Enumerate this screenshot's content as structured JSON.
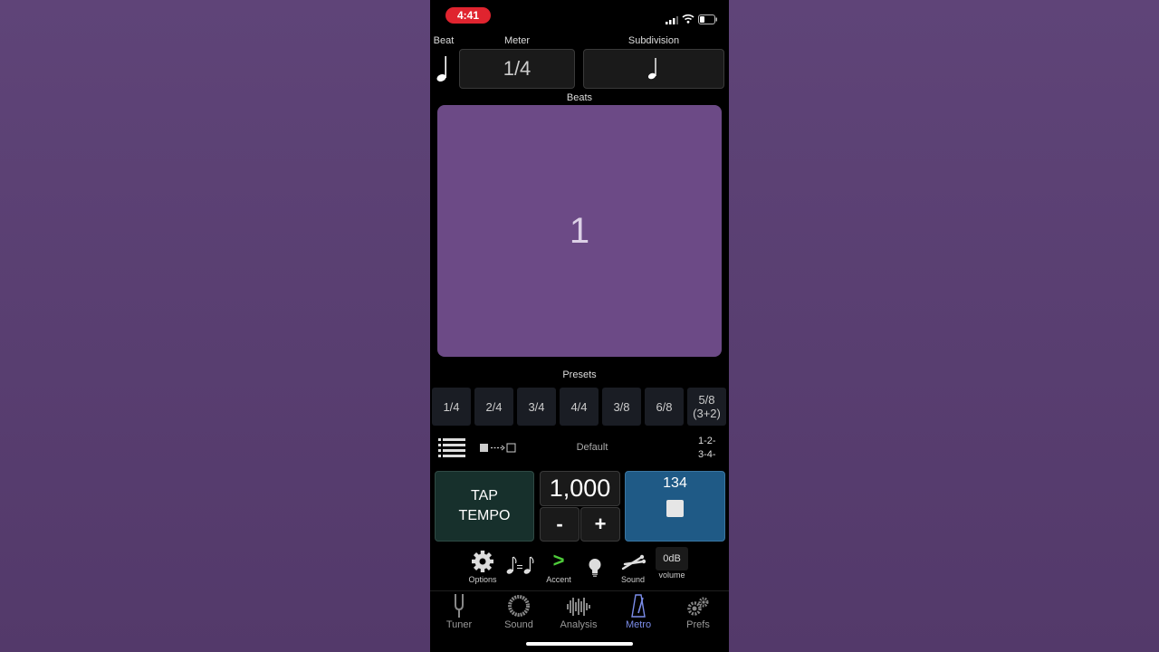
{
  "status": {
    "time": "4:41"
  },
  "header": {
    "beat_label": "Beat",
    "meter_label": "Meter",
    "subdivision_label": "Subdivision",
    "meter_value": "1/4",
    "beats_label": "Beats"
  },
  "beats": {
    "current": "1"
  },
  "presets": {
    "label": "Presets",
    "items": [
      "1/4",
      "2/4",
      "3/4",
      "4/4",
      "3/8",
      "6/8",
      "5/8"
    ],
    "last_sub": "(3+2)",
    "default_label": "Default",
    "count_top": "1-2-",
    "count_bottom": "3-4-"
  },
  "controls": {
    "tap_line1": "TAP",
    "tap_line2": "TEMPO",
    "count": "1,000",
    "minus": "-",
    "plus": "+",
    "bpm": "134",
    "options": "Options",
    "accent": "Accent",
    "accent_symbol": ">",
    "sound": "Sound",
    "db": "0dB",
    "volume": "volume"
  },
  "tabs": {
    "tuner": "Tuner",
    "sound": "Sound",
    "analysis": "Analysis",
    "metro": "Metro",
    "prefs": "Prefs"
  },
  "colors": {
    "background": "#5f4478",
    "beats_panel": "#6c4a86",
    "play_button": "#1f5a86",
    "tap_button": "#17302c",
    "accent": "#4ecb3a",
    "active_tab": "#7b8dea"
  }
}
